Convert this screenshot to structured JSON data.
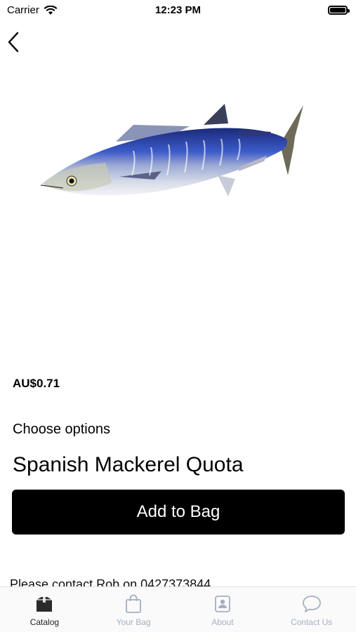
{
  "status_bar": {
    "carrier": "Carrier",
    "time": "12:23 PM"
  },
  "nav": {
    "back_icon": "chevron-left-icon"
  },
  "product": {
    "image_icon": "spanish-mackerel-image",
    "price": "AU$0.71",
    "choose_options_label": "Choose options",
    "title": "Spanish Mackerel Quota",
    "add_button_label": "Add to Bag",
    "contact_note": "Please contact Rob on 0427373844"
  },
  "tab_bar": {
    "active_color": "#222222",
    "inactive_color": "#a5afc2",
    "items": [
      {
        "label": "Catalog",
        "icon": "catalog-box-icon",
        "active": true
      },
      {
        "label": "Your Bag",
        "icon": "bag-icon",
        "active": false
      },
      {
        "label": "About",
        "icon": "about-icon",
        "active": false
      },
      {
        "label": "Contact Us",
        "icon": "chat-bubble-icon",
        "active": false
      }
    ]
  }
}
